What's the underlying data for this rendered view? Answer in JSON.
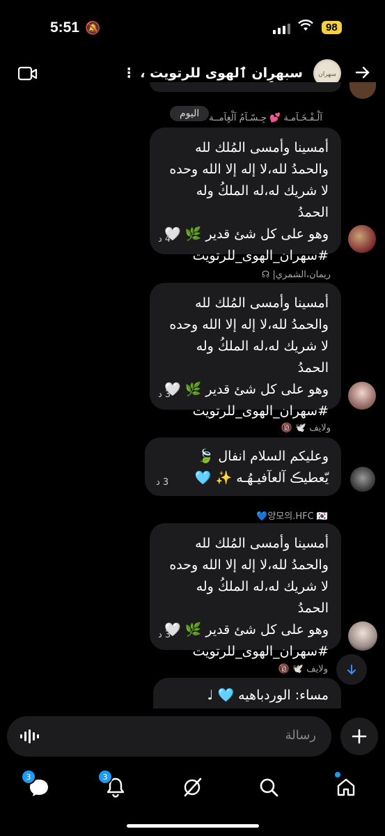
{
  "status_bar": {
    "time": "5:51",
    "battery": "98"
  },
  "header": {
    "title": "سبهرِان ٱلهوى للرتويت ، ⋮",
    "back_icon": "arrow-right-icon",
    "video_icon": "video-icon"
  },
  "top_sender_name": "آلْـفْـخَـآمـة 💕 جِـسّـآمُ آلْغٍآمــة",
  "day_label": "اليوم",
  "messages": [
    {
      "sender": "",
      "text": "أمسينا وأمسى المُلك لله\nوالحمدُ لله،لا إله إلا الله وحده\nلا شريك له،له الملكُ وله الحمدُ\nوهو على كل شئ قدير 🌿 🤍\n#سهران_الهوى_للرتويت",
      "time": "4 د"
    },
    {
      "sender": "ريمان،الشمري| ☊",
      "text": "أمسينا وأمسى المُلك لله\nوالحمدُ لله،لا إله إلا الله وحده\nلا شريك له،له الملكُ وله الحمدُ\nوهو على كل شئ قدير 🌿 🤍\n#سهران_الهوى_للرتويت",
      "time": "3 د"
    },
    {
      "sender": "ولايف 🕊️ 🔞",
      "text": "وعليكم السلام انفال 🍃\nيّعطيڪ آلعآفيـهُـه ✨ 🩵",
      "time": "3 د"
    },
    {
      "sender": "양모의.HFC 🇰🇷💙",
      "text": "أمسينا وأمسى المُلك لله\nوالحمدُ لله،لا إله إلا الله وحده\nلا شريك له،له الملكُ وله الحمدُ\nوهو على كل شئ قدير 🌿 🤍\n#سهران_الهوى_للرتويت",
      "time": "3 د"
    },
    {
      "sender": "ولايف 🕊️ 🔞",
      "text": "مساء:  الوردباهيه 🩵 ♩",
      "time": ""
    }
  ],
  "composer": {
    "placeholder": "رسالة"
  },
  "tabs": {
    "messages_badge": "3",
    "notifications_badge": "3"
  }
}
